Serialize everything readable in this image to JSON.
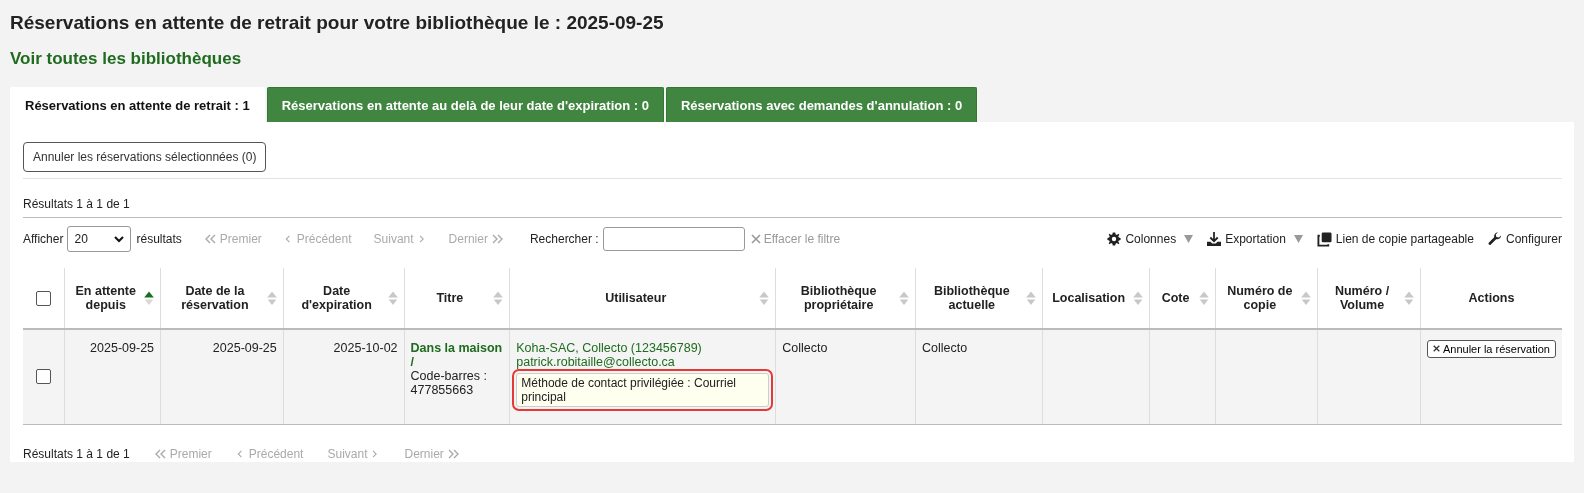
{
  "page_title": "Réservations en attente de retrait pour votre bibliothèque le : 2025-09-25",
  "all_libraries_link": "Voir toutes les bibliothèques",
  "tabs": [
    {
      "label": "Réservations en attente de retrait : 1",
      "selected": true
    },
    {
      "label": "Réservations en attente au delà de leur date d'expiration : 0",
      "selected": false
    },
    {
      "label": "Réservations avec demandes d'annulation : 0",
      "selected": false
    }
  ],
  "cancel_selected_button": "Annuler les réservations sélectionnées (0)",
  "results_top": "Résultats 1 à 1 de 1",
  "toolbar": {
    "show_label": "Afficher",
    "page_size": "20",
    "results_label": "résultats",
    "pager": [
      {
        "kind": "first",
        "label": "Premier",
        "disabled": true
      },
      {
        "kind": "previous",
        "label": "Précédent",
        "disabled": true
      },
      {
        "kind": "next",
        "label": "Suivant",
        "disabled": true
      },
      {
        "kind": "last",
        "label": "Dernier",
        "disabled": true
      }
    ],
    "search_label": "Rechercher :",
    "clear_filter": "Effacer le filtre",
    "actions": [
      {
        "kind": "columns",
        "label": "Colonnes",
        "dropdown": true
      },
      {
        "kind": "export",
        "label": "Exportation",
        "dropdown": true
      },
      {
        "kind": "copy",
        "label": "Lien de copie partageable",
        "dropdown": false
      },
      {
        "kind": "configure",
        "label": "Configurer",
        "dropdown": false
      }
    ]
  },
  "table": {
    "select_all_checked": false,
    "columns": [
      {
        "label": "En attente depuis",
        "sortable": true,
        "sorted": true
      },
      {
        "label": "Date de la réservation",
        "sortable": true,
        "sorted": false
      },
      {
        "label": "Date d'expiration",
        "sortable": true,
        "sorted": false
      },
      {
        "label": "Titre",
        "sortable": true,
        "sorted": false
      },
      {
        "label": "Utilisateur",
        "sortable": true,
        "sorted": false
      },
      {
        "label": "Bibliothèque propriétaire",
        "sortable": true,
        "sorted": false
      },
      {
        "label": "Bibliothèque actuelle",
        "sortable": true,
        "sorted": false
      },
      {
        "label": "Localisation",
        "sortable": true,
        "sorted": false
      },
      {
        "label": "Cote",
        "sortable": true,
        "sorted": false
      },
      {
        "label": "Numéro de copie",
        "sortable": true,
        "sorted": false
      },
      {
        "label": "Numéro / Volume",
        "sortable": true,
        "sorted": false
      },
      {
        "label": "Actions",
        "sortable": false
      }
    ],
    "rows": [
      {
        "checked": false,
        "waiting_since": "2025-09-25",
        "reservation_date": "2025-09-25",
        "expiration_date": "2025-10-02",
        "title": "Dans la maison /",
        "barcode": "Code-barres : 477855663",
        "patron": "Koha-SAC, Collecto (123456789)",
        "email": "patrick.robitaille@collecto.ca",
        "contact_method": "Méthode de contact privilégiée : Courriel principal",
        "contact_highlighted": true,
        "home_library": "Collecto",
        "current_library": "Collecto",
        "action": "Annuler la réservation"
      }
    ]
  },
  "results_bottom": "Résultats 1 à 1 de 1",
  "pager_bottom": [
    {
      "kind": "first",
      "label": "Premier",
      "disabled": true
    },
    {
      "kind": "previous",
      "label": "Précédent",
      "disabled": true
    },
    {
      "kind": "next",
      "label": "Suivant",
      "disabled": true
    },
    {
      "kind": "last",
      "label": "Dernier",
      "disabled": true
    }
  ]
}
